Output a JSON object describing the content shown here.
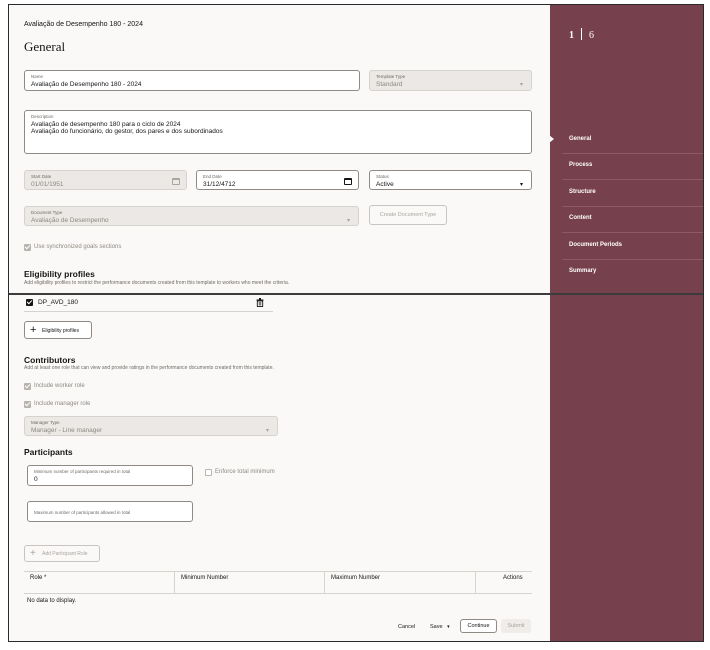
{
  "app_title": "Avaliação de Desempenho 180 - 2024",
  "page_title": "General",
  "name": {
    "label": "Name",
    "value": "Avaliação de Desempenho 180 - 2024"
  },
  "template_type": {
    "label": "Template Type",
    "value": "Standard"
  },
  "description": {
    "label": "Description",
    "line1": "Avaliação de desempenho 180 para o ciclo de 2024",
    "line2": "Avaliação do funcionário, do gestor, dos pares e dos subordinados"
  },
  "start_date": {
    "label": "Start Date",
    "value": "01/01/1951"
  },
  "end_date": {
    "label": "End Date",
    "value": "31/12/4712"
  },
  "status": {
    "label": "Status",
    "value": "Active"
  },
  "document_type": {
    "label": "Document Type",
    "value": "Avaliação de Desempenho"
  },
  "create_document_type": "Create Document Type",
  "use_sync_goals": "Use synchronized goals sections",
  "eligibility": {
    "title": "Eligibility profiles",
    "subtitle": "Add eligibility profiles to restrict the performance documents created from this template to workers who meet the criteria.",
    "profile": "DP_AVD_180",
    "add_button": "Eligibility profiles"
  },
  "contributors": {
    "title": "Contributors",
    "subtitle": "Add at least one role that can view and provide ratings in the performance documents created from this template.",
    "include_worker": "Include worker role",
    "include_manager": "Include manager role",
    "manager_type_label": "Manager Type",
    "manager_type_value": "Manager - Line manager"
  },
  "participants": {
    "title": "Participants",
    "min_label": "Minimum number of participants required in total",
    "min_value": "0",
    "enforce": "Enforce total minimum",
    "max_label": "Maximum number of participants allowed in total",
    "add_role": "Add Participant Role"
  },
  "table": {
    "headers": [
      "Role *",
      "Minimum Number",
      "Maximum Number",
      "Actions"
    ],
    "empty": "No data to display."
  },
  "footer": {
    "cancel": "Cancel",
    "save": "Save",
    "continue": "Continue",
    "submit": "Submit"
  },
  "stepper": {
    "current": "1",
    "total": "6"
  },
  "nav": [
    "General",
    "Process",
    "Structure",
    "Content",
    "Document Periods",
    "Summary"
  ],
  "colors": {
    "sidebar": "#76404c",
    "background": "#fbf9f8"
  }
}
